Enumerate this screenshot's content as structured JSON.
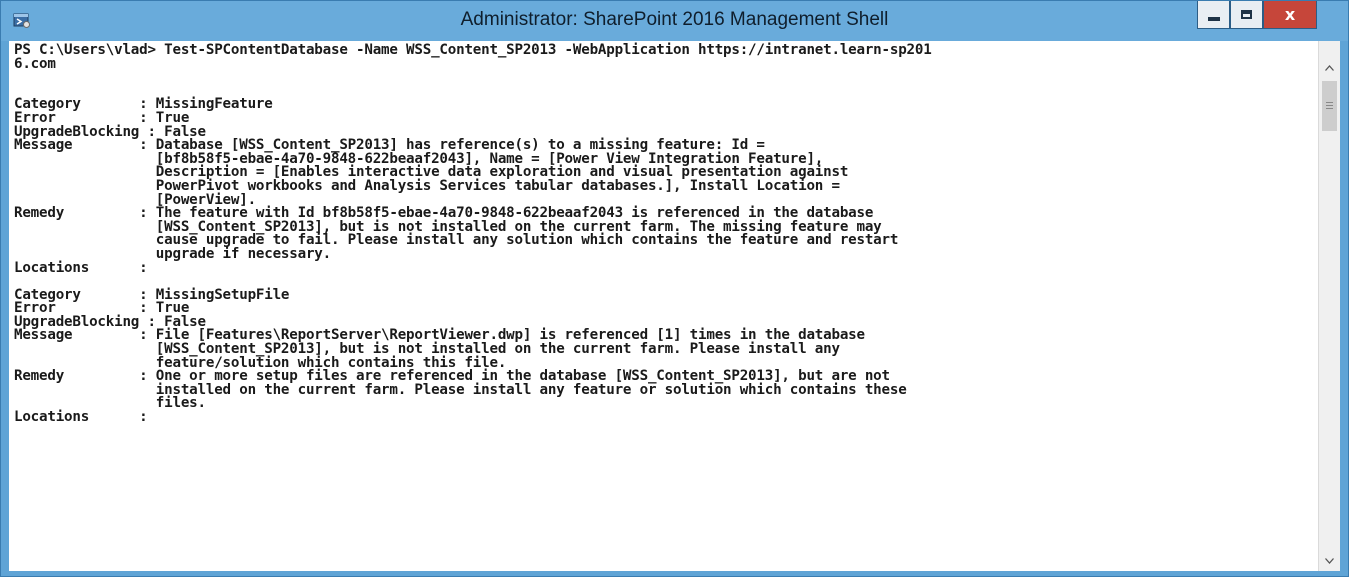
{
  "window": {
    "title": "Administrator: SharePoint 2016 Management Shell",
    "icon": "powershell-icon",
    "controls": {
      "minimize_icon": "minimize-icon",
      "maximize_icon": "maximize-icon",
      "close_label": "x"
    },
    "colors": {
      "frame": "#69abdb",
      "close_button": "#c6463a",
      "console_background": "#ffffff",
      "console_text": "#1a1a1a"
    }
  },
  "console": {
    "lines": [
      "PS C:\\Users\\vlad> Test-SPContentDatabase -Name WSS_Content_SP2013 -WebApplication https://intranet.learn-sp201",
      "6.com",
      "",
      "",
      "Category       : MissingFeature",
      "Error          : True",
      "UpgradeBlocking : False",
      "Message        : Database [WSS_Content_SP2013] has reference(s) to a missing feature: Id =",
      "                 [bf8b58f5-ebae-4a70-9848-622beaaf2043], Name = [Power View Integration Feature],",
      "                 Description = [Enables interactive data exploration and visual presentation against",
      "                 PowerPivot workbooks and Analysis Services tabular databases.], Install Location =",
      "                 [PowerView].",
      "Remedy         : The feature with Id bf8b58f5-ebae-4a70-9848-622beaaf2043 is referenced in the database",
      "                 [WSS_Content_SP2013], but is not installed on the current farm. The missing feature may",
      "                 cause upgrade to fail. Please install any solution which contains the feature and restart",
      "                 upgrade if necessary.",
      "Locations      :",
      "",
      "Category       : MissingSetupFile",
      "Error          : True",
      "UpgradeBlocking : False",
      "Message        : File [Features\\ReportServer\\ReportViewer.dwp] is referenced [1] times in the database",
      "                 [WSS_Content_SP2013], but is not installed on the current farm. Please install any",
      "                 feature/solution which contains this file.",
      "Remedy         : One or more setup files are referenced in the database [WSS_Content_SP2013], but are not",
      "                 installed on the current farm. Please install any feature or solution which contains these",
      "                 files.",
      "Locations      :"
    ]
  },
  "scrollbar": {
    "up_icon": "scroll-up-arrow-icon",
    "down_icon": "scroll-down-arrow-icon"
  }
}
